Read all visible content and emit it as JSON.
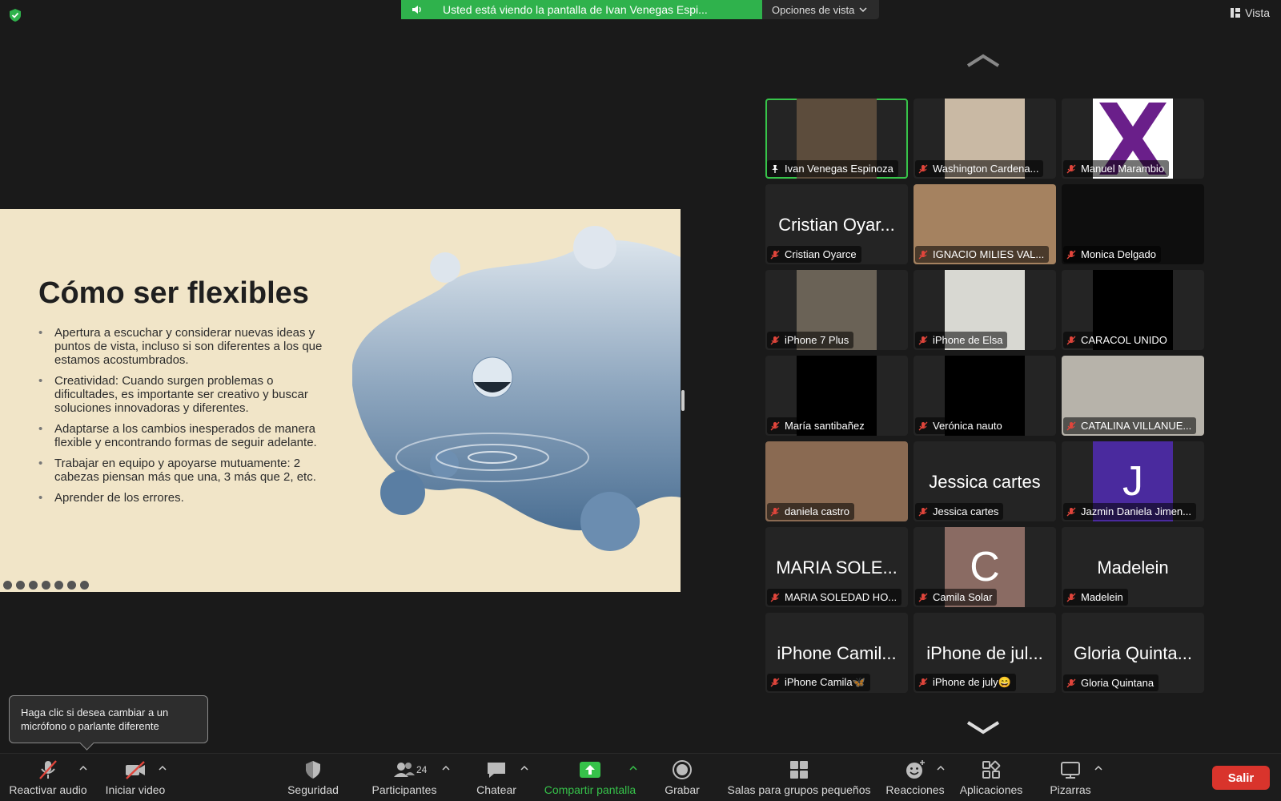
{
  "top_bar": {
    "banner_text": "Usted está viendo la pantalla de Ivan Venegas Espi...",
    "view_options_label": "Opciones de vista",
    "view_label": "Vista"
  },
  "slide": {
    "title": "Cómo ser flexibles",
    "bullets": [
      "Apertura a escuchar y considerar nuevas ideas y puntos de vista, incluso si son diferentes a los que estamos acostumbrados.",
      "Creatividad: Cuando surgen problemas o dificultades, es importante ser creativo y buscar soluciones innovadoras y diferentes.",
      "Adaptarse a los cambios inesperados de manera flexible y encontrando formas de seguir adelante.",
      "Trabajar en equipo y apoyarse mutuamente: 2 cabezas piensan más que una, 3 más que 2, etc.",
      "Aprender de los errores."
    ]
  },
  "participants": [
    {
      "name": "Ivan Venegas Espinoza",
      "big": "",
      "video": "#5c4c3c",
      "active": true,
      "pinned": true
    },
    {
      "name": "Washington Cardena...",
      "big": "",
      "video": "#c9b9a4"
    },
    {
      "name": "Manuel Marambio",
      "big": "",
      "video": "#ffffff",
      "logo": true
    },
    {
      "name": "Cristian Oyarce",
      "big": "Cristian Oyar...",
      "video": ""
    },
    {
      "name": "IGNACIO MILIES VAL...",
      "big": "",
      "video": "#a58260",
      "wide": true
    },
    {
      "name": "Monica Delgado",
      "big": "",
      "video": "#0e0e0e",
      "wide": true
    },
    {
      "name": "iPhone 7 Plus",
      "big": "",
      "video": "#6a6256"
    },
    {
      "name": "iPhone de Elsa",
      "big": "",
      "video": "#d8d8d2"
    },
    {
      "name": "CARACOL UNIDO",
      "big": "",
      "video": "#000000"
    },
    {
      "name": "María santibañez",
      "big": "",
      "video": "#000000"
    },
    {
      "name": "Verónica nauto",
      "big": "",
      "video": "#000000"
    },
    {
      "name": "CATALINA VILLANUE...",
      "big": "",
      "video": "#b7b3aa",
      "wide": true
    },
    {
      "name": "daniela castro",
      "big": "",
      "video": "#8a6a52",
      "wide": true
    },
    {
      "name": "Jessica cartes",
      "big": "Jessica cartes",
      "video": ""
    },
    {
      "name": "Jazmin Daniela Jimen...",
      "big": "",
      "video": "#4a2a9e",
      "letter": "J"
    },
    {
      "name": "MARIA SOLEDAD HO...",
      "big": "MARIA SOLE...",
      "video": ""
    },
    {
      "name": "Camila Solar",
      "big": "",
      "video": "#8a6b63",
      "letter": "C"
    },
    {
      "name": "Madelein",
      "big": "Madelein",
      "video": ""
    },
    {
      "name": "iPhone Camila🦋",
      "big": "iPhone Camil...",
      "video": ""
    },
    {
      "name": "iPhone de july😄",
      "big": "iPhone de jul...",
      "video": ""
    },
    {
      "name": "Gloria Quintana",
      "big": "Gloria Quinta...",
      "video": ""
    }
  ],
  "tooltip": {
    "text": "Haga clic si desea cambiar a un micrófono o parlante diferente"
  },
  "toolbar": {
    "audio": "Reactivar audio",
    "video": "Iniciar video",
    "security": "Seguridad",
    "participants": "Participantes",
    "participant_count": "24",
    "chat": "Chatear",
    "share": "Compartir pantalla",
    "record": "Grabar",
    "breakout": "Salas para grupos pequeños",
    "reactions": "Reacciones",
    "apps": "Aplicaciones",
    "whiteboards": "Pizarras",
    "leave": "Salir"
  },
  "colors": {
    "share_green": "#36c24a",
    "leave_red": "#d9342c",
    "active_border": "#37c44a",
    "muted_red": "#e0453b"
  }
}
